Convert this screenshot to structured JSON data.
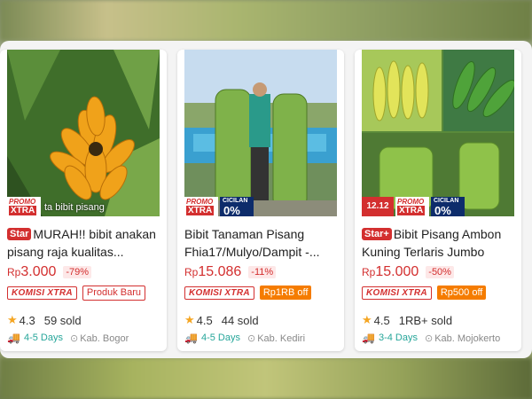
{
  "products": [
    {
      "star_label": "Star",
      "title": "MURAH!! bibit anakan pisang raja kualitas...",
      "price_prefix": "Rp",
      "price_value": "3.000",
      "discount": "-79%",
      "komisi": "KOMISI XTRA",
      "extra_tag": "Produk Baru",
      "rating": "4.3",
      "sold": "59 sold",
      "delivery": "4-5 Days",
      "location": "Kab. Bogor",
      "image_caption": "ta bibit pisang",
      "promo_top": "PROMO",
      "promo_bottom": "XTRA"
    },
    {
      "title": "Bibit Tanaman Pisang Fhia17/Mulyo/Dampit -...",
      "price_prefix": "Rp",
      "price_value": "15.086",
      "discount": "-11%",
      "komisi": "KOMISI XTRA",
      "extra_tag": "Rp1RB off",
      "rating": "4.5",
      "sold": "44 sold",
      "delivery": "4-5 Days",
      "location": "Kab. Kediri",
      "promo_top": "PROMO",
      "promo_bottom": "XTRA",
      "cicilan_top": "CICILAN",
      "cicilan_bottom": "0%"
    },
    {
      "star_label": "Star+",
      "title": "Bibit Pisang Ambon Kuning Terlaris Jumbo",
      "price_prefix": "Rp",
      "price_value": "15.000",
      "discount": "-50%",
      "komisi": "KOMISI XTRA",
      "extra_tag": "Rp500 off",
      "rating": "4.5",
      "sold": "1RB+ sold",
      "delivery": "3-4 Days",
      "location": "Kab. Mojokerto",
      "sale": "12.12",
      "promo_top": "PROMO",
      "promo_bottom": "XTRA",
      "cicilan_top": "CICILAN",
      "cicilan_bottom": "0%"
    }
  ],
  "colors": {
    "price_red": "#d32f2f",
    "delivery_teal": "#26a69a",
    "cicilan_navy": "#0d2c6b",
    "chip_orange": "#f57c00",
    "star_gold": "#f5a623"
  }
}
